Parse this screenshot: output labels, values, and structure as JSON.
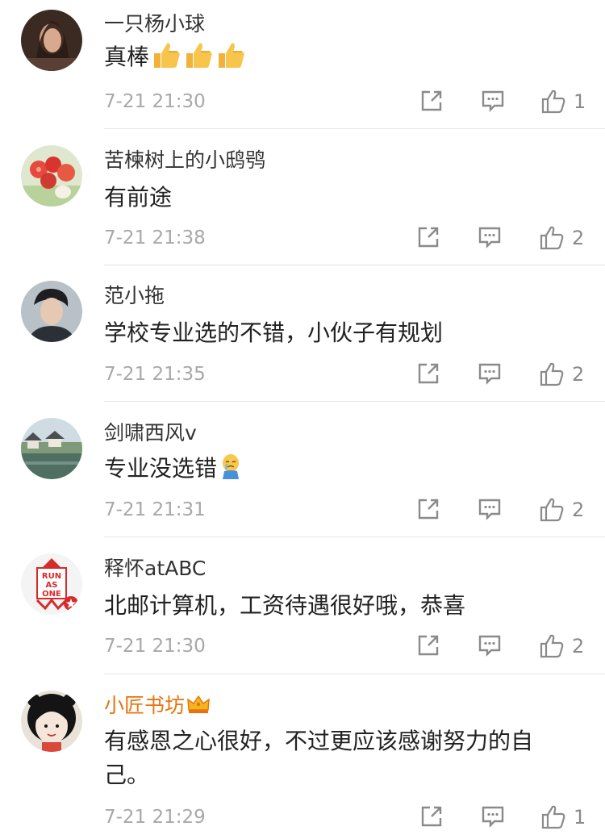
{
  "comments": [
    {
      "name": "一只杨小球",
      "text": "真棒",
      "emojis": [
        "thumbs-up-emoji",
        "thumbs-up-emoji",
        "thumbs-up-emoji"
      ],
      "time": "7-21 21:30",
      "likes": "1"
    },
    {
      "name": "苦楝树上的小鸱鸮",
      "text": "有前途",
      "time": "7-21 21:38",
      "likes": "2"
    },
    {
      "name": "范小拖",
      "text": "学校专业选的不错，小伙子有规划",
      "time": "7-21 21:35",
      "likes": "2"
    },
    {
      "name": "剑啸西风v",
      "text": "专业没选错",
      "emojis": [
        "crying-figure-emoji"
      ],
      "time": "7-21 21:31",
      "likes": "2"
    },
    {
      "name": "释怀atABC",
      "text": "北邮计算机，工资待遇很好哦，恭喜",
      "time": "7-21 21:30",
      "likes": "2",
      "avatar_text": [
        "RUN",
        "AS",
        "ONE"
      ]
    },
    {
      "name": "小匠书坊",
      "vip_badge": "crown-icon",
      "text": "有感恩之心很好，不过更应该感谢努力的自己。",
      "time": "7-21 21:29",
      "likes": "1"
    }
  ],
  "icons": {
    "share": "share-icon",
    "reply": "comment-icon",
    "like": "thumbs-up-icon"
  },
  "colors": {
    "name": "#333333",
    "vip_name": "#e8730e",
    "time": "#a8a8a8",
    "divider": "#e6e6e6",
    "icon": "#8a8a8a"
  }
}
